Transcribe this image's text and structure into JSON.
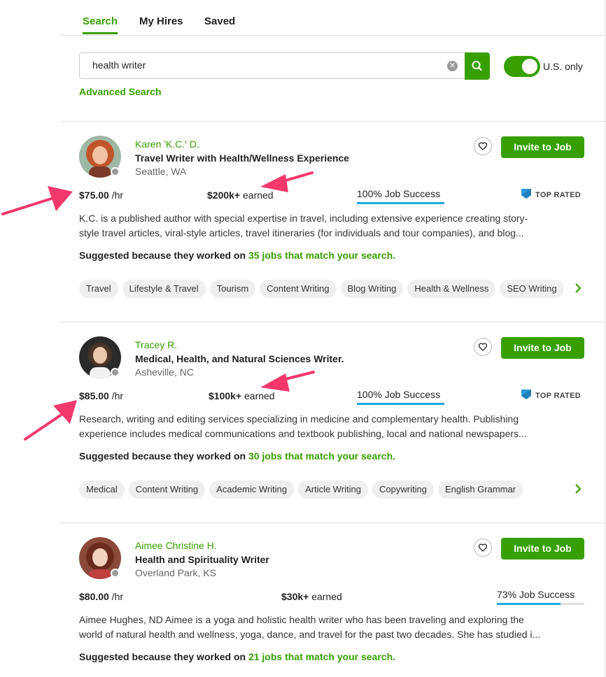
{
  "tabs": [
    {
      "label": "Search"
    },
    {
      "label": "My Hires"
    },
    {
      "label": "Saved"
    }
  ],
  "search": {
    "value": "health writer",
    "advanced_label": "Advanced Search",
    "us_only_label": "U.S. only",
    "us_only_enabled": true
  },
  "colors": {
    "accent": "#37a000",
    "jss_bar": "#1fa8e1",
    "top_rated_badge": "#1f7fb6",
    "annotation_arrow": "#f5386b"
  },
  "freelancers": [
    {
      "name": "Karen 'K.C.' D.",
      "title": "Travel Writer with Health/Wellness Experience",
      "location": "Seattle, WA",
      "rate": "$75.00",
      "rate_unit": "/hr",
      "earned_amount": "$200k+",
      "earned_label": "earned",
      "job_success": "100% Job Success",
      "job_success_pct": 100,
      "badge": "TOP RATED",
      "invite_label": "Invite to Job",
      "description_line1": "K.C. is a published author with special expertise in travel, including extensive experience creating story-",
      "description_line2": "style travel articles, viral-style articles, travel itineraries (for individuals and tour companies), and blog...",
      "suggested_prefix": "Suggested because they worked on",
      "suggested_link": "35 jobs that match your search.",
      "skills": [
        "Travel",
        "Lifestyle & Travel",
        "Tourism",
        "Content Writing",
        "Blog Writing",
        "Health & Wellness",
        "SEO Writing"
      ]
    },
    {
      "name": "Tracey R.",
      "title": "Medical, Health, and Natural Sciences Writer.",
      "location": "Asheville, NC",
      "rate": "$85.00",
      "rate_unit": "/hr",
      "earned_amount": "$100k+",
      "earned_label": "earned",
      "job_success": "100% Job Success",
      "job_success_pct": 100,
      "badge": "TOP RATED",
      "invite_label": "Invite to Job",
      "description_line1": "Research, writing and editing services specializing in medicine and complementary health. Publishing",
      "description_line2": "experience includes medical communications and textbook publishing, local and national newspapers...",
      "suggested_prefix": "Suggested because they worked on",
      "suggested_link": "30 jobs that match your search.",
      "skills": [
        "Medical",
        "Content Writing",
        "Academic Writing",
        "Article Writing",
        "Copywriting",
        "English Grammar"
      ]
    },
    {
      "name": "Aimee Christine H.",
      "title": "Health and Spirituality Writer",
      "location": "Overland Park, KS",
      "rate": "$80.00",
      "rate_unit": "/hr",
      "earned_amount": "$30k+",
      "earned_label": "earned",
      "job_success": "73% Job Success",
      "job_success_pct": 73,
      "invite_label": "Invite to Job",
      "description_line1": "Aimee Hughes, ND Aimee is a yoga and holistic health writer who has been traveling and exploring the",
      "description_line2": "world of natural health and wellness, yoga, dance, and travel for the past two decades. She has studied i...",
      "suggested_prefix": "Suggested because they worked on",
      "suggested_link": "21 jobs that match your search."
    }
  ]
}
